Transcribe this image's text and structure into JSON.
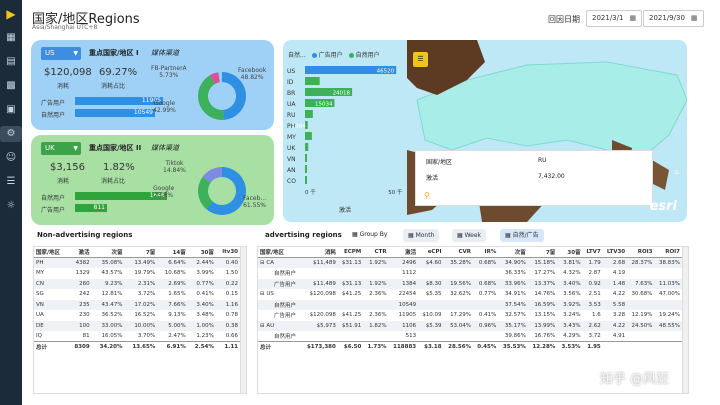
{
  "header": {
    "title": "国家/地区Regions",
    "subtitle": "Asia/Shanghai UTC+8",
    "date_label": "回因日期",
    "start_date": "2021/3/1",
    "end_date": "2021/9/30"
  },
  "sidebar": {
    "icons": [
      "logo-icon",
      "grid-icon",
      "table-icon",
      "film-icon",
      "image-icon",
      "settings-icon",
      "people-icon",
      "document-icon",
      "compass-icon"
    ]
  },
  "card_us": {
    "country": "US",
    "title": "重点国家/地区 I",
    "subtitle": "媒体渠道",
    "spend": "$120,098",
    "spend_label": "消耗",
    "share": "69.27%",
    "share_label": "消耗占比",
    "ad_label": "广告用户",
    "ad_users": "11905",
    "organic_label": "自然用户",
    "organic_users": "10549",
    "slices": [
      {
        "name": "Facebook",
        "pct": "48.82%",
        "value": 48.82,
        "color": "#2f8fe3"
      },
      {
        "name": "Google",
        "pct": "42.99%",
        "value": 42.99,
        "color": "#3cb05a"
      },
      {
        "name": "FB-PartnerA",
        "pct": "5.73%",
        "value": 5.73,
        "color": "#e44b9a"
      },
      {
        "name": "Other",
        "pct": "",
        "value": 2.46,
        "color": "#8ad3f7"
      }
    ]
  },
  "card_uk": {
    "country": "UK",
    "title": "重点国家/地区 II",
    "subtitle": "媒体渠道",
    "spend": "$3,156",
    "spend_label": "消耗",
    "share": "1.82%",
    "share_label": "消耗占比",
    "ad_label": "自然用户",
    "ad_users": "1646",
    "organic_label": "广告用户",
    "organic_users": "811",
    "slices": [
      {
        "name": "Faceb...",
        "pct": "61.55%",
        "value": 61.55,
        "color": "#2f8fe3"
      },
      {
        "name": "Google",
        "pct": "23.6%",
        "value": 23.6,
        "color": "#3cb05a"
      },
      {
        "name": "Tiktok",
        "pct": "14.84%",
        "value": 14.84,
        "color": "#7f8be0"
      }
    ]
  },
  "bar_chart": {
    "legend_title": "自然...",
    "legend": [
      {
        "name": "广告用户",
        "color": "#2f8fe3"
      },
      {
        "name": "自然用户",
        "color": "#3cb05a"
      }
    ],
    "x_ticks": [
      "0 千",
      "50 千"
    ],
    "x_label": "激活"
  },
  "chart_data": {
    "type": "bar",
    "categories": [
      "US",
      "ID",
      "BR",
      "UA",
      "RU",
      "PH",
      "MY",
      "UK",
      "VN",
      "AN",
      "CO"
    ],
    "series": [
      {
        "name": "广告用户",
        "values": [
          46520,
          7476,
          24018,
          15034,
          4000,
          1384,
          3500,
          1646,
          1000,
          500,
          300
        ]
      }
    ],
    "xlim": [
      0,
      50000
    ],
    "value_labels": [
      "46520",
      "",
      "24018",
      "15034",
      "",
      "1384",
      "",
      "",
      "",
      "",
      ""
    ]
  },
  "map": {
    "popup_region_label": "国家/地区",
    "popup_region": "RU",
    "popup_metric_label": "激活",
    "popup_metric": "7,432.00",
    "logo": "esri"
  },
  "left_table": {
    "title": "Non-advertising regions",
    "headers": [
      "国家/地区",
      "激活",
      "次留",
      "7留",
      "14留",
      "30留",
      "ltv30"
    ],
    "rows": [
      [
        "PH",
        "4382",
        "35.08%",
        "13.49%",
        "6.64%",
        "2.44%",
        "0.40"
      ],
      [
        "MY",
        "1329",
        "43.57%",
        "19.79%",
        "10.68%",
        "3.99%",
        "1.50"
      ],
      [
        "CN",
        "260",
        "9.23%",
        "2.31%",
        "2.69%",
        "0.77%",
        "0.22"
      ],
      [
        "SG",
        "242",
        "12.81%",
        "3.72%",
        "1.65%",
        "0.41%",
        "0.15"
      ],
      [
        "VN",
        "235",
        "43.47%",
        "17.02%",
        "7.66%",
        "3.40%",
        "1.16"
      ],
      [
        "UA",
        "230",
        "36.52%",
        "16.52%",
        "9.13%",
        "3.48%",
        "0.78"
      ],
      [
        "DE",
        "100",
        "33.00%",
        "10.00%",
        "5.00%",
        "1.00%",
        "0.38"
      ],
      [
        "IQ",
        "81",
        "16.05%",
        "3.70%",
        "2.47%",
        "1.23%",
        "0.66"
      ]
    ],
    "total": [
      "总计",
      "8309",
      "34.20%",
      "13.65%",
      "6.91%",
      "2.54%",
      "1.11"
    ]
  },
  "right_table": {
    "title": "advertising regions",
    "group_by": "Group By",
    "btn_month": "Month",
    "btn_week": "Week",
    "btn_organic": "自然/广告",
    "headers": [
      "国家/地区",
      "消耗",
      "ECPM",
      "CTR",
      "激活",
      "eCPI",
      "CVR",
      "IR%",
      "次留",
      "7留",
      "30留",
      "LTV7",
      "LTV30",
      "ROI3",
      "ROI7"
    ],
    "rows": [
      [
        "CA",
        "$11,489",
        "$31.13",
        "1.92%",
        "2496",
        "$4.60",
        "35.28%",
        "0.68%",
        "34.90%",
        "15.18%",
        "3.81%",
        "1.79",
        "2.68",
        "28.37%",
        "38.83%"
      ],
      [
        "自然用户",
        "",
        "",
        "",
        "1112",
        "",
        "",
        "",
        "36.33%",
        "17.27%",
        "4.32%",
        "2.87",
        "4.19",
        "",
        ""
      ],
      [
        "广告用户",
        "$11,489",
        "$31.13",
        "1.92%",
        "1384",
        "$8.30",
        "19.56%",
        "0.68%",
        "33.96%",
        "13.37%",
        "3.40%",
        "0.92",
        "1.48",
        "7.63%",
        "11.03%"
      ],
      [
        "US",
        "$120,098",
        "$41.25",
        "2.36%",
        "22454",
        "$5.35",
        "32.62%",
        "0.77%",
        "34.91%",
        "14.76%",
        "3.56%",
        "2.51",
        "4.22",
        "30.68%",
        "47.00%"
      ],
      [
        "自然用户",
        "",
        "",
        "",
        "10549",
        "",
        "",
        "",
        "37.54%",
        "16.59%",
        "3.92%",
        "3.53",
        "5.58",
        "",
        ""
      ],
      [
        "广告用户",
        "$120,098",
        "$41.25",
        "2.36%",
        "11905",
        "$10.09",
        "17.29%",
        "0.41%",
        "32.57%",
        "13.15%",
        "3.24%",
        "1.6",
        "3.28",
        "12.19%",
        "19.24%"
      ],
      [
        "AU",
        "$5,973",
        "$51.91",
        "1.82%",
        "1106",
        "$5.39",
        "53.04%",
        "0.96%",
        "35.17%",
        "13.99%",
        "3.43%",
        "2.62",
        "4.22",
        "24.50%",
        "48.55%"
      ],
      [
        "自然用户",
        "",
        "",
        "",
        "513",
        "",
        "",
        "",
        "39.86%",
        "16.76%",
        "4.29%",
        "3.72",
        "4.91",
        "",
        ""
      ]
    ],
    "total": [
      "总计",
      "$173,380",
      "$6.50",
      "1.73%",
      "118883",
      "$3.18",
      "28.56%",
      "0.45%",
      "35.53%",
      "12.28%",
      "3.53%",
      "1.95",
      "",
      "",
      ""
    ]
  },
  "watermark": "知乎 @风狂"
}
